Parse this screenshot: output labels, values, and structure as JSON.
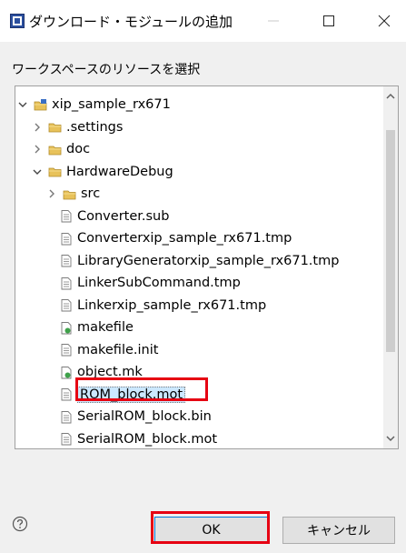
{
  "window": {
    "title": "ダウンロード・モジュールの追加",
    "minimize_icon": "minimize-icon",
    "maximize_icon": "maximize-icon",
    "close_icon": "close-icon"
  },
  "instruction": "ワークスペースのリソースを選択",
  "tree": {
    "items": [
      {
        "label": "xip_sample_rx671",
        "icon": "project-folder-icon",
        "expander": "expanded"
      },
      {
        "label": ".settings",
        "icon": "folder-icon",
        "expander": "collapsed"
      },
      {
        "label": "doc",
        "icon": "folder-icon",
        "expander": "collapsed"
      },
      {
        "label": "HardwareDebug",
        "icon": "folder-icon",
        "expander": "expanded"
      },
      {
        "label": "src",
        "icon": "folder-icon",
        "expander": "collapsed"
      },
      {
        "label": "Converter.sub",
        "icon": "file-icon"
      },
      {
        "label": "Converterxip_sample_rx671.tmp",
        "icon": "file-icon"
      },
      {
        "label": "LibraryGeneratorxip_sample_rx671.tmp",
        "icon": "file-icon"
      },
      {
        "label": "LinkerSubCommand.tmp",
        "icon": "file-icon"
      },
      {
        "label": "Linkerxip_sample_rx671.tmp",
        "icon": "file-icon"
      },
      {
        "label": "makefile",
        "icon": "makefile-icon"
      },
      {
        "label": "makefile.init",
        "icon": "file-icon"
      },
      {
        "label": "object.mk",
        "icon": "makefile-icon"
      },
      {
        "label": "ROM_block.mot",
        "icon": "file-icon",
        "selected": true
      },
      {
        "label": "SerialROM_block.bin",
        "icon": "file-icon"
      },
      {
        "label": "SerialROM_block.mot",
        "icon": "file-icon"
      }
    ]
  },
  "buttons": {
    "ok": "OK",
    "cancel": "キャンセル",
    "help_icon": "help-icon"
  },
  "colors": {
    "highlight_box": "#e60012",
    "selection": "#cce8ff",
    "folder": "#e8c25a"
  }
}
